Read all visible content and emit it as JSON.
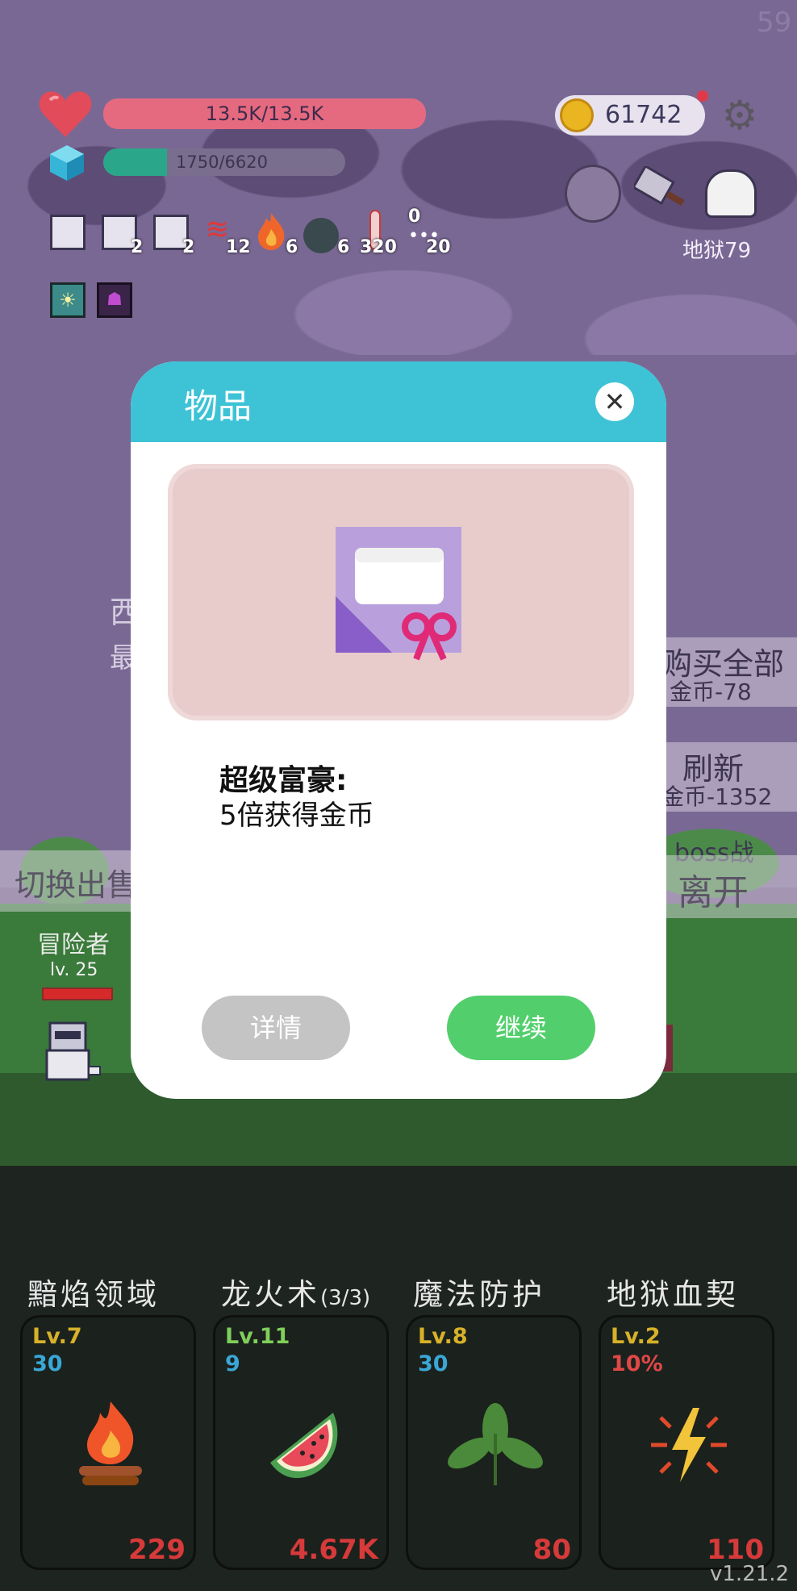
{
  "hud": {
    "hp_text": "13.5K/13.5K",
    "xp_text": "1750/6620",
    "xp_progress": 0.264,
    "coins": "61742",
    "fps": "59"
  },
  "status_effects": [
    {
      "icon": "scroll-icon",
      "count": ""
    },
    {
      "icon": "scroll-icon",
      "count": "2"
    },
    {
      "icon": "scroll-icon",
      "count": "2"
    },
    {
      "icon": "heat-waves-icon",
      "count": "12"
    },
    {
      "icon": "fire-icon",
      "count": "6"
    },
    {
      "icon": "bomb-icon",
      "count": "6"
    },
    {
      "icon": "thermometer-icon",
      "count": "320"
    },
    {
      "icon": "dots-icon",
      "count": "20",
      "top": "0"
    }
  ],
  "stage": {
    "label": "地狱79"
  },
  "behind_modal": {
    "left_1": "西",
    "left_2": "最",
    "buy_all": "购买全部",
    "buy_all_cost": "金币-78",
    "refresh": "刷新",
    "refresh_cost": "金币-1352",
    "boss_label": "boss战",
    "leave": "离开",
    "switch_sell": "切换出售"
  },
  "hero": {
    "name": "冒险者",
    "level": "lv. 25"
  },
  "modal": {
    "title": "物品",
    "item_name": "超级富豪:",
    "item_desc": "5倍获得金币",
    "details_label": "详情",
    "continue_label": "继续"
  },
  "skills": [
    {
      "title": "黯焰领域",
      "level": "Lv.7",
      "value": "30",
      "value_color": "#3aa7d6",
      "icon": "campfire-icon",
      "cost": "229"
    },
    {
      "title": "龙火术",
      "title_suffix": "(3/3)",
      "level": "Lv.11",
      "value": "9",
      "value_color": "#3aa7d6",
      "icon": "watermelon-icon",
      "cost": "4.67K"
    },
    {
      "title": "魔法防护",
      "level": "Lv.8",
      "value": "30",
      "value_color": "#3aa7d6",
      "icon": "leaf-icon",
      "cost": "80"
    },
    {
      "title": "地狱血契",
      "level": "Lv.2",
      "value": "10%",
      "value_color": "#e04848",
      "icon": "lightning-icon",
      "cost": "110"
    }
  ],
  "version": "v1.21.2",
  "colors": {
    "level_yellow": "#d6b12a",
    "level_green": "#7fcf5a",
    "modal_header": "#3ec3d6",
    "continue": "#52cf6c"
  }
}
